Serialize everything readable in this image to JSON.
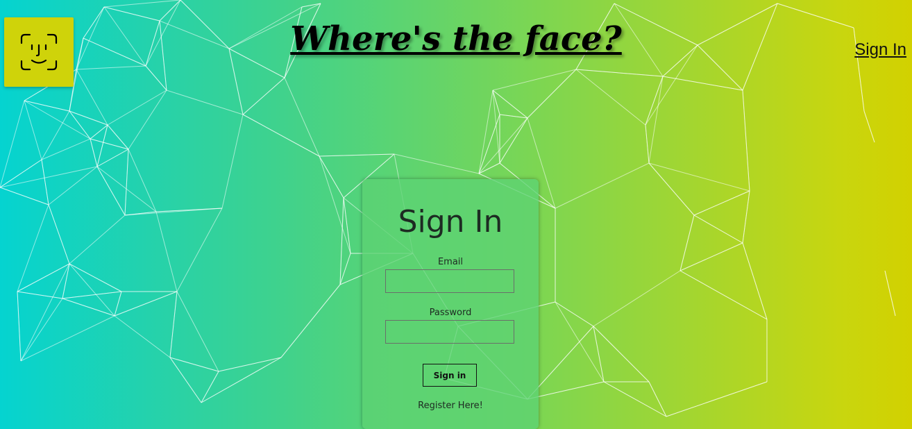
{
  "header": {
    "logo_icon": "face-id-icon",
    "title": "Where's the face?",
    "nav_signin": "Sign In"
  },
  "form": {
    "title": "Sign In",
    "email_label": "Email",
    "email_value": "",
    "password_label": "Password",
    "password_value": "",
    "submit_label": "Sign in",
    "register_link": "Register Here!"
  },
  "background": {
    "gradient_colors": [
      "#05d3d0",
      "#3ed28e",
      "#7fd650",
      "#c8d60f",
      "#d2d100"
    ],
    "pattern": "white polygon network"
  }
}
